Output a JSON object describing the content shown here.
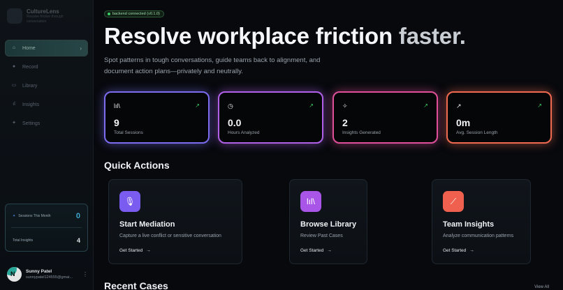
{
  "app": {
    "name": "CultureLens",
    "tagline": "Resolve friction through conversation"
  },
  "sidebar": {
    "items": [
      {
        "label": "Home",
        "icon": "home-icon",
        "active": true
      },
      {
        "label": "Record",
        "icon": "mic-icon",
        "active": false
      },
      {
        "label": "Library",
        "icon": "book-icon",
        "active": false
      },
      {
        "label": "Insights",
        "icon": "bar-chart-icon",
        "active": false
      },
      {
        "label": "Settings",
        "icon": "sparkle-icon",
        "active": false
      }
    ],
    "stats": {
      "sessions_label": "Sessions This Month",
      "sessions_value": "0",
      "insights_label": "Total Insights",
      "insights_value": "4"
    },
    "user": {
      "initial": "N",
      "name": "Sunny Patel",
      "email": "sunnypatel124555@gmai..."
    }
  },
  "header": {
    "badge": "backend connected (v0.1.0)",
    "title_main": "Resolve workplace friction",
    "title_accent": "faster.",
    "subtitle": "Spot patterns in tough conversations, guide teams back to alignment, and document action plans—privately and neutrally."
  },
  "stats": [
    {
      "value": "9",
      "label": "Total Sessions",
      "icon": "library-icon",
      "color": "#7b6cf0"
    },
    {
      "value": "0.0",
      "label": "Hours Analyzed",
      "icon": "clock-icon",
      "color": "#b061e8"
    },
    {
      "value": "2",
      "label": "Insights Generated",
      "icon": "sparkle-icon",
      "color": "#e0509a"
    },
    {
      "value": "0m",
      "label": "Avg. Session Length",
      "icon": "trend-up-icon",
      "color": "#f06a52"
    }
  ],
  "quick_actions": {
    "title": "Quick Actions",
    "items": [
      {
        "title": "Start Mediation",
        "desc": "Capture a live conflict or sensitive conversation",
        "link": "Get Started",
        "icon": "mic-icon",
        "color": "#7a5cf0"
      },
      {
        "title": "Browse Library",
        "desc": "Review Past Cases",
        "link": "Get Started",
        "icon": "library-icon",
        "color": "#a855e8"
      },
      {
        "title": "Team Insights",
        "desc": "Analyze communication patterns",
        "link": "Get Started",
        "icon": "chart-icon",
        "color": "#f0604e"
      }
    ]
  },
  "recent": {
    "title": "Recent Cases",
    "view_all": "View All"
  }
}
